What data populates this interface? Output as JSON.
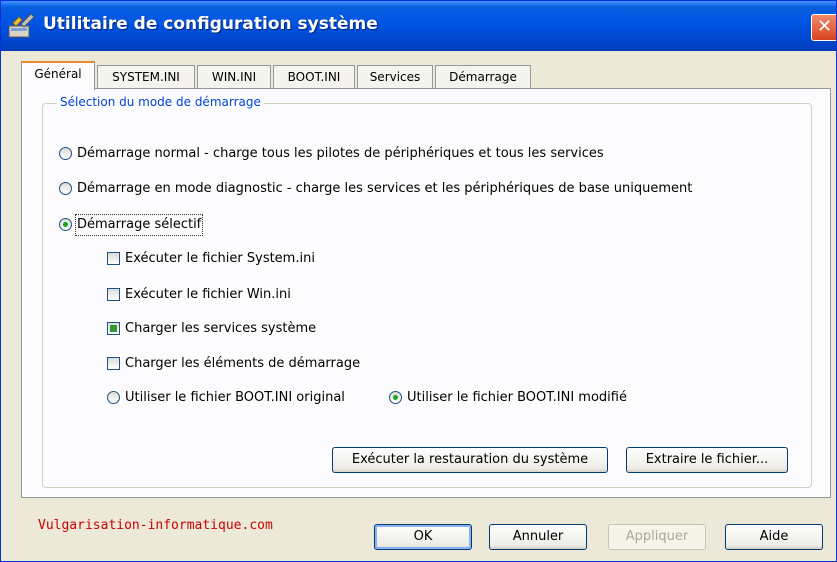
{
  "window": {
    "title": "Utilitaire de configuration système",
    "close_label": "✕",
    "icon": "config-tools-icon"
  },
  "tabs": [
    {
      "label": "Général",
      "active": true
    },
    {
      "label": "SYSTEM.INI",
      "active": false
    },
    {
      "label": "WIN.INI",
      "active": false
    },
    {
      "label": "BOOT.INI",
      "active": false
    },
    {
      "label": "Services",
      "active": false
    },
    {
      "label": "Démarrage",
      "active": false
    }
  ],
  "group": {
    "legend": "Sélection du mode de démarrage",
    "modes": [
      {
        "label": "Démarrage normal - charge tous les pilotes de périphériques et tous les services",
        "selected": false
      },
      {
        "label": "Démarrage en mode diagnostic - charge les services et les périphériques de base uniquement",
        "selected": false
      },
      {
        "label": "Démarrage sélectif",
        "selected": true
      }
    ],
    "options": [
      {
        "label": "Exécuter le fichier System.ini",
        "checked": false
      },
      {
        "label": "Exécuter le fichier Win.ini",
        "checked": false
      },
      {
        "label": "Charger les services système",
        "checked": true
      },
      {
        "label": "Charger les éléments de démarrage",
        "checked": false
      }
    ],
    "boot_ini": [
      {
        "label": "Utiliser le fichier BOOT.INI original",
        "selected": false
      },
      {
        "label": "Utiliser le fichier BOOT.INI modifié",
        "selected": true
      }
    ],
    "restore_button": "Exécuter la restauration du système",
    "extract_button": "Extraire le fichier..."
  },
  "footer": {
    "watermark": "Vulgarisation-informatique.com",
    "ok": "OK",
    "cancel": "Annuler",
    "apply": "Appliquer",
    "help": "Aide"
  },
  "colors": {
    "titlebar": "#0054e3",
    "accent_tab": "#e68b2c",
    "legend_text": "#0046d5",
    "watermark": "#cc0000",
    "check_green": "#2f9a2f"
  }
}
